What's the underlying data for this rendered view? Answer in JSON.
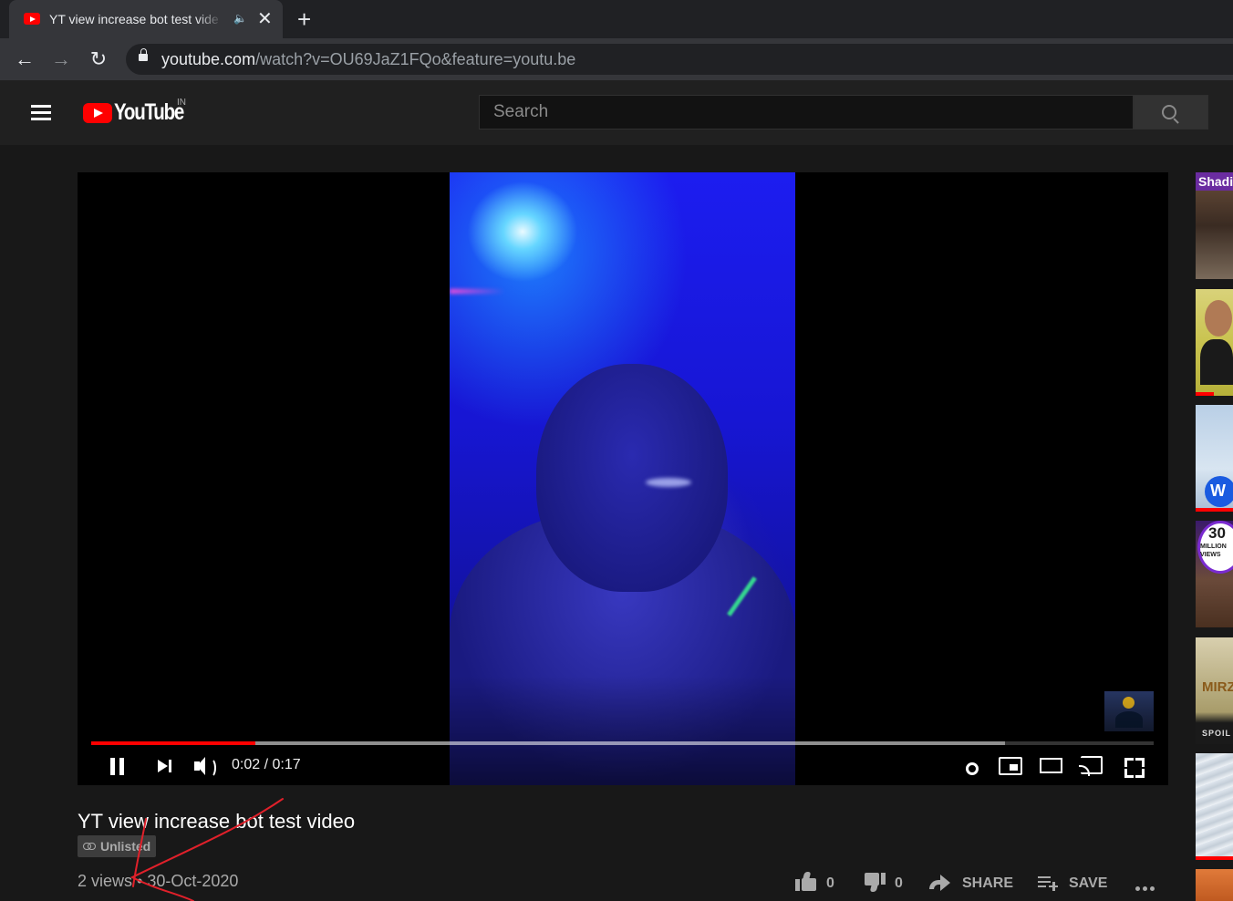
{
  "browser": {
    "tab": {
      "title": "YT view increase bot test vide"
    },
    "new_tab_label": "+",
    "url": {
      "host": "youtube.com",
      "path": "/watch?v=OU69JaZ1FQo&feature=youtu.be"
    }
  },
  "masthead": {
    "logo_text": "YouTube",
    "country_code": "IN",
    "search": {
      "placeholder": "Search",
      "value": ""
    }
  },
  "player": {
    "time": "0:02 / 0:17",
    "current_seconds": 2,
    "duration_seconds": 17,
    "buffered_fraction": 0.86,
    "state": "playing"
  },
  "video": {
    "title": "YT view increase bot test video",
    "visibility": "Unlisted",
    "views": "2 views",
    "separator": "•",
    "date": "30-Oct-2020",
    "likes": "0",
    "dislikes": "0",
    "share_label": "SHARE",
    "save_label": "SAVE"
  },
  "sidebar": {
    "thumbs": [
      {
        "overlay_text": "Shadi",
        "has_progress": false
      },
      {
        "overlay_text": "",
        "has_progress": true
      },
      {
        "overlay_text": "",
        "has_progress": true
      },
      {
        "overlay_text": "30",
        "overlay_sub": "MILLION VIEWS",
        "has_progress": false
      },
      {
        "overlay_text": "MIRZ",
        "overlay_sub": "SPOIL",
        "has_progress": false
      },
      {
        "overlay_text": "",
        "has_progress": true
      },
      {
        "overlay_text": "",
        "has_progress": false
      }
    ]
  },
  "colors": {
    "brand_red": "#ff0000",
    "page_bg": "#181818",
    "masthead_bg": "#202020",
    "annotation_pen": "#e0202a"
  },
  "icons": {
    "tab_audio": "speaker-icon",
    "tab_close": "close-icon",
    "back": "arrow-left-icon",
    "forward": "arrow-right-icon",
    "reload": "reload-icon",
    "lock": "lock-icon",
    "menu": "hamburger-menu-icon",
    "search": "search-icon"
  }
}
